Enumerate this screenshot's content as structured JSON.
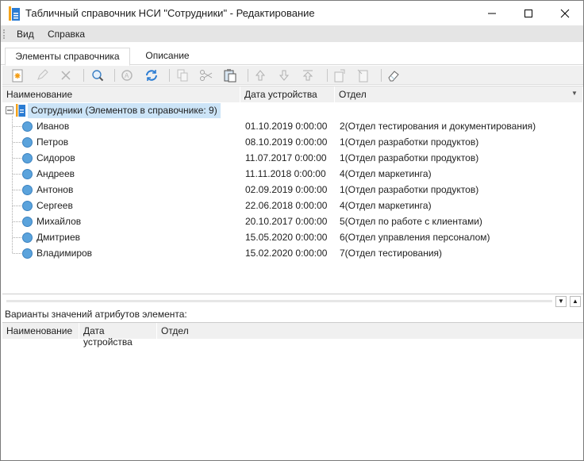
{
  "window": {
    "title": "Табличный справочник НСИ \"Сотрудники\" - Редактирование"
  },
  "menu": [
    "Вид",
    "Справка"
  ],
  "tabs": [
    "Элементы справочника",
    "Описание"
  ],
  "grid": {
    "columns": [
      "Наименование",
      "Дата устройства",
      "Отдел"
    ],
    "root": "Сотрудники (Элементов в справочнике: 9)",
    "rows": [
      {
        "name": "Иванов",
        "date": "01.10.2019 0:00:00",
        "dept": "2(Отдел тестирования и документирования)"
      },
      {
        "name": "Петров",
        "date": "08.10.2019 0:00:00",
        "dept": "1(Отдел разработки продуктов)"
      },
      {
        "name": "Сидоров",
        "date": "11.07.2017 0:00:00",
        "dept": "1(Отдел разработки продуктов)"
      },
      {
        "name": "Андреев",
        "date": "11.11.2018 0:00:00",
        "dept": "4(Отдел маркетинга)"
      },
      {
        "name": "Антонов",
        "date": "02.09.2019 0:00:00",
        "dept": "1(Отдел разработки продуктов)"
      },
      {
        "name": "Сергеев",
        "date": "22.06.2018 0:00:00",
        "dept": "4(Отдел маркетинга)"
      },
      {
        "name": "Михайлов",
        "date": "20.10.2017 0:00:00",
        "dept": "5(Отдел по работе с клиентами)"
      },
      {
        "name": "Дмитриев",
        "date": "15.05.2020 0:00:00",
        "dept": "6(Отдел управления персоналом)"
      },
      {
        "name": "Владимиров",
        "date": "15.02.2020 0:00:00",
        "dept": "7(Отдел тестирования)"
      }
    ]
  },
  "lower": {
    "label": "Варианты значений атрибутов элемента:",
    "columns": [
      "Наименование",
      "Дата устройства",
      "Отдел"
    ]
  },
  "colors": {
    "accent": "#5ba3dc",
    "selection": "#cce4f7"
  }
}
